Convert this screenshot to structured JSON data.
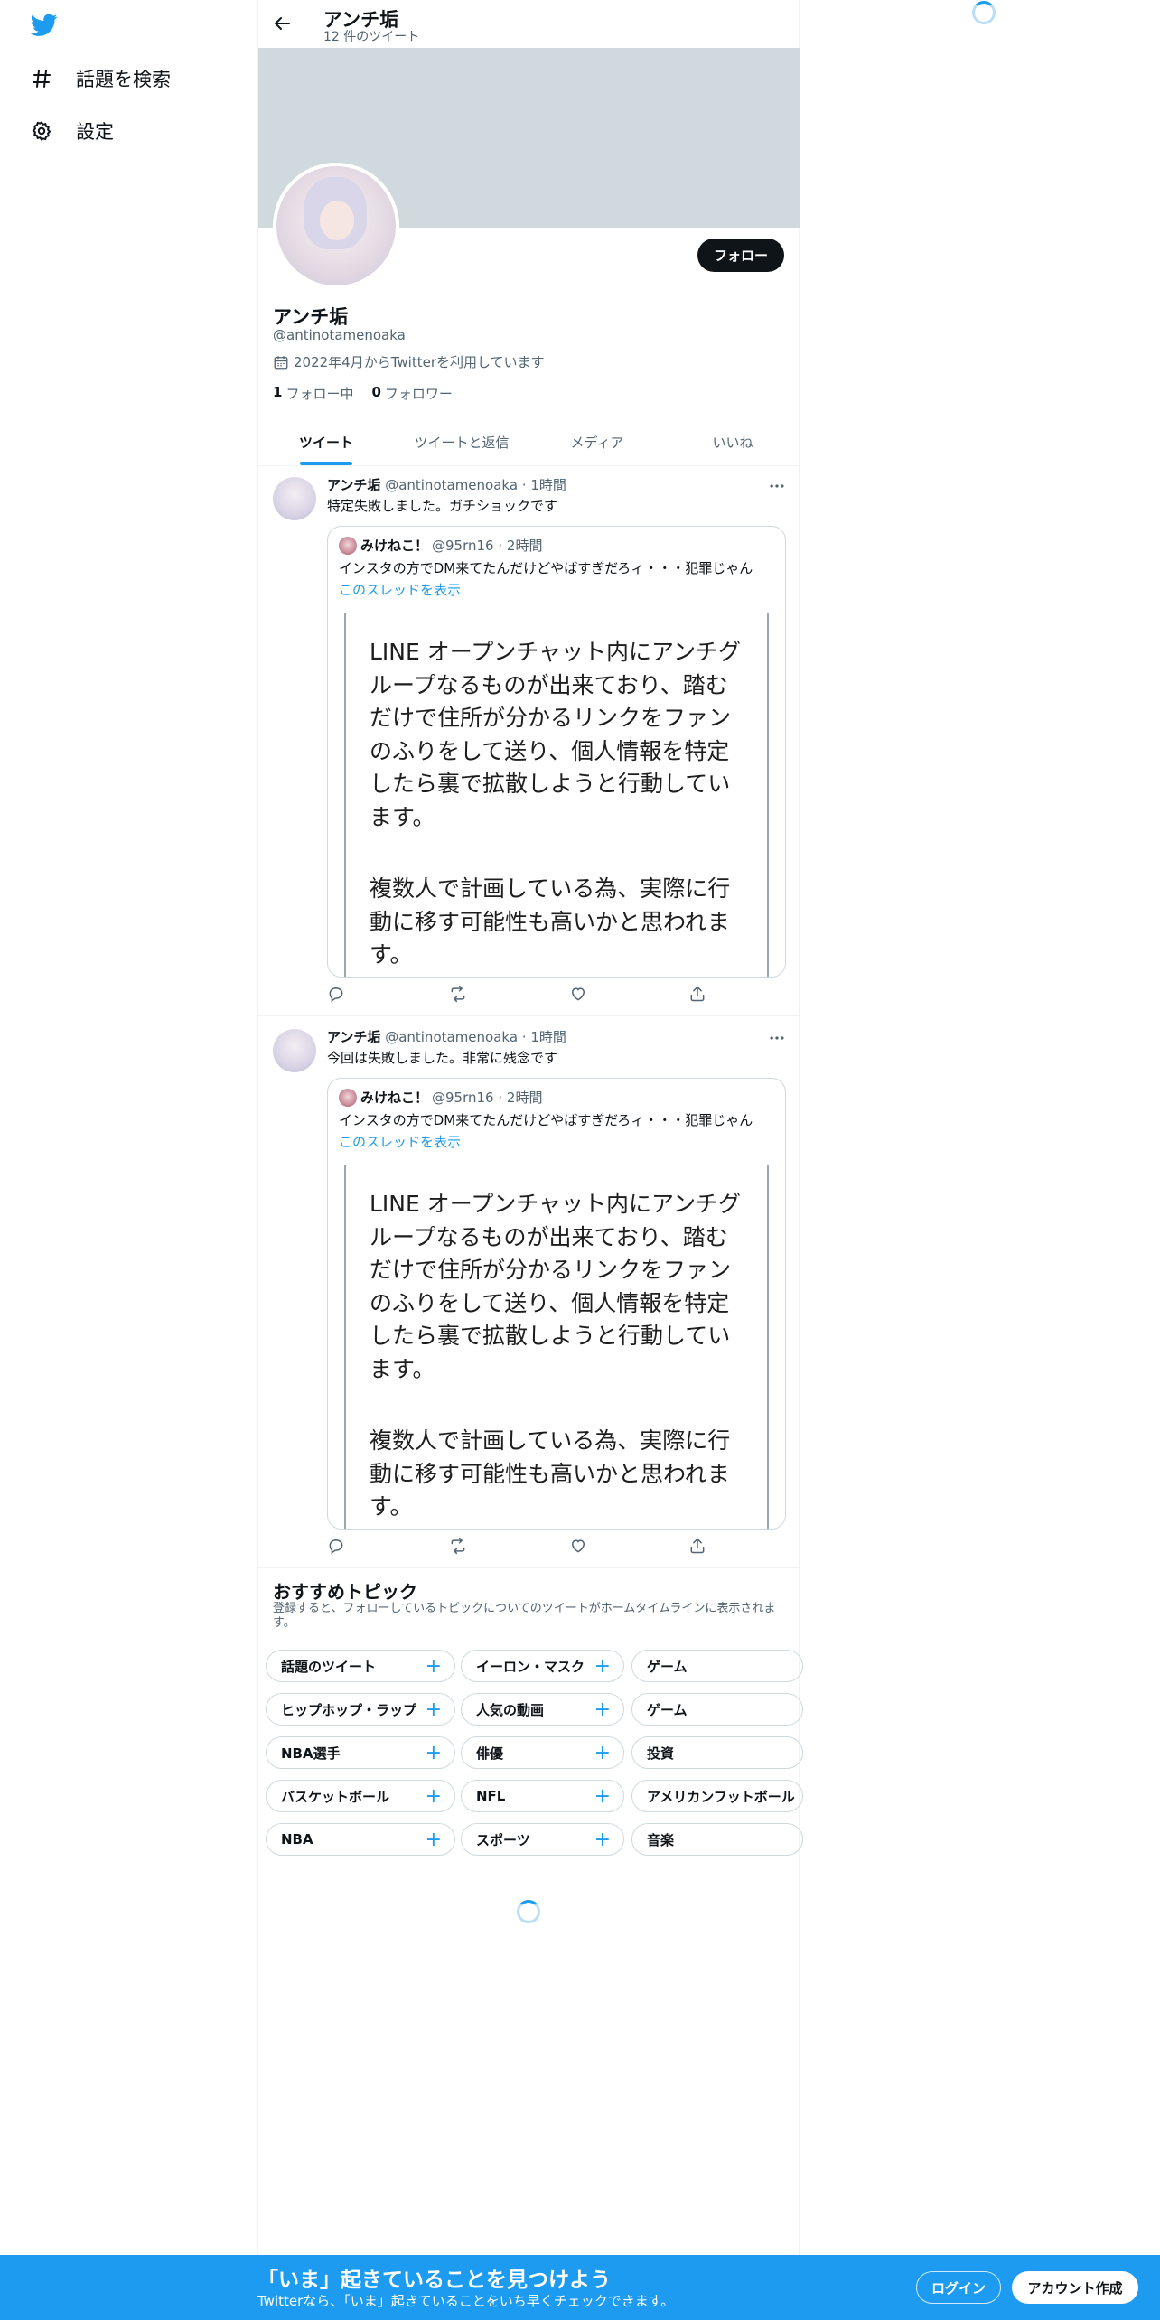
{
  "nav": {
    "logo": "twitter-bird-icon",
    "items": [
      {
        "label": "話題を検索",
        "icon": "hashtag-icon"
      },
      {
        "label": "設定",
        "icon": "gear-icon"
      }
    ]
  },
  "header": {
    "title": "アンチ垢",
    "subtitle": "12 件のツイート"
  },
  "profile": {
    "display_name": "アンチ垢",
    "handle": "@antinotamenoaka",
    "joined": "2022年4月からTwitterを利用しています",
    "following_count": "1",
    "following_label": "フォロー中",
    "followers_count": "0",
    "followers_label": "フォロワー",
    "follow_button": "フォロー"
  },
  "tabs": [
    {
      "label": "ツイート",
      "active": true
    },
    {
      "label": "ツイートと返信",
      "active": false
    },
    {
      "label": "メディア",
      "active": false
    },
    {
      "label": "いいね",
      "active": false
    }
  ],
  "tweets": [
    {
      "name": "アンチ垢",
      "meta": "@antinotamenoaka · 1時間",
      "text": "特定失敗しました。ガチショックです",
      "quote": {
        "name": "みけねこ！",
        "meta": "@95rn16 · 2時間",
        "text": "インスタの方でDM来てたんだけどやばすぎだろィ・・・犯罪じゃん",
        "link": "このスレッドを表示",
        "media_para1": "LINE オープンチャット内にアンチグループなるものが出来ており、踏むだけで住所が分かるリンクをファンのふりをして送り、個人情報を特定したら裏で拡散しようと行動しています。",
        "media_para2": "複数人で計画している為、実際に行動に移す可能性も高いかと思われます。"
      }
    },
    {
      "name": "アンチ垢",
      "meta": "@antinotamenoaka · 1時間",
      "text": "今回は失敗しました。非常に残念です",
      "quote": {
        "name": "みけねこ！",
        "meta": "@95rn16 · 2時間",
        "text": "インスタの方でDM来てたんだけどやばすぎだろィ・・・犯罪じゃん",
        "link": "このスレッドを表示",
        "media_para1": "LINE オープンチャット内にアンチグループなるものが出来ており、踏むだけで住所が分かるリンクをファンのふりをして送り、個人情報を特定したら裏で拡散しようと行動しています。",
        "media_para2": "複数人で計画している為、実際に行動に移す可能性も高いかと思われます。"
      }
    }
  ],
  "topics": {
    "title": "おすすめトピック",
    "subtitle": "登録すると、フォローしているトピックについてのツイートがホームタイムラインに表示されます。",
    "rows": [
      [
        "話題のツイート",
        "イーロン・マスク",
        "ゲーム"
      ],
      [
        "ヒップホップ・ラップ",
        "人気の動画",
        "ゲーム"
      ],
      [
        "NBA選手",
        "俳優",
        "投資"
      ],
      [
        "バスケットボール",
        "NFL",
        "アメリカンフットボール"
      ],
      [
        "NBA",
        "スポーツ",
        "音楽"
      ]
    ],
    "plus": "+"
  },
  "bottom_bar": {
    "title": "「いま」起きていることを見つけよう",
    "subtitle": "Twitterなら、「いま」起きていることをいち早くチェックできます。",
    "login": "ログイン",
    "signup": "アカウント作成"
  },
  "colors": {
    "accent": "#1d9bf0",
    "banner": "#cfd9de",
    "text": "#0f1419",
    "muted": "#536471"
  }
}
